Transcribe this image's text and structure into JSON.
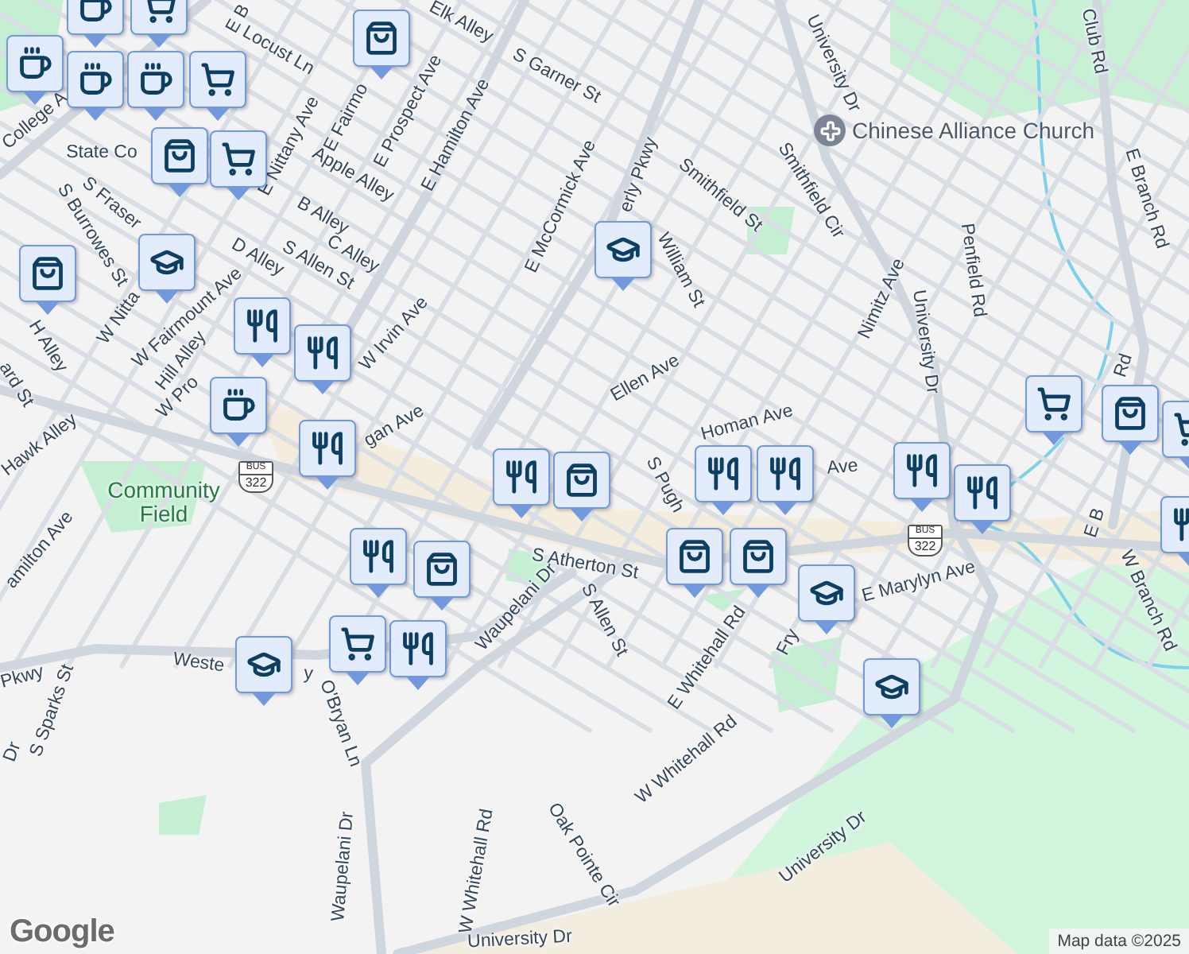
{
  "street_labels": [
    {
      "text": "Elk Alley"
    },
    {
      "text": "Locust Ln"
    },
    {
      "text": "S Garner St"
    },
    {
      "text": "E Fairmo"
    },
    {
      "text": "E Prospect Ave"
    },
    {
      "text": "E Hamilton Ave"
    },
    {
      "text": "Apple Alley"
    },
    {
      "text": "E Nittany Ave"
    },
    {
      "text": "B Alley"
    },
    {
      "text": "C Alley"
    },
    {
      "text": "S Allen St"
    },
    {
      "text": "D Alley"
    },
    {
      "text": "S Fraser"
    },
    {
      "text": "S Burrowes St"
    },
    {
      "text": "W Nitta"
    },
    {
      "text": "W Fairmount Ave"
    },
    {
      "text": "Hill Alley"
    },
    {
      "text": "W Irvin Ave"
    },
    {
      "text": "H Alley"
    },
    {
      "text": "Hawk Alley"
    },
    {
      "text": "E McCormick Ave"
    },
    {
      "text": "Smithfield St"
    },
    {
      "text": "Smithfield Cir"
    },
    {
      "text": "University Dr"
    },
    {
      "text": "Club Rd"
    },
    {
      "text": "E Branch Rd"
    },
    {
      "text": "Penfield Rd"
    },
    {
      "text": "Nimitz Ave"
    },
    {
      "text": "University Dr"
    },
    {
      "text": "Ellen Ave"
    },
    {
      "text": "Homan Ave"
    },
    {
      "text": "Ave"
    },
    {
      "text": "S Pugh"
    },
    {
      "text": "S Atherton St"
    },
    {
      "text": "S Allen St"
    },
    {
      "text": "E Whitehall Rd"
    },
    {
      "text": "Fry"
    },
    {
      "text": "E Marylyn Ave"
    },
    {
      "text": "W Branch Rd"
    },
    {
      "text": "Waupelani Dr"
    },
    {
      "text": "Waupelani Dr"
    },
    {
      "text": "O'Bryan Ln"
    },
    {
      "text": "Weste"
    },
    {
      "text": "y"
    },
    {
      "text": "Pkwy"
    },
    {
      "text": "S Sparks St"
    },
    {
      "text": "amilton Ave"
    },
    {
      "text": "W Whitehall Rd"
    },
    {
      "text": "Oak Pointe Cir"
    },
    {
      "text": "W Whitehall Rd"
    },
    {
      "text": "University Dr"
    },
    {
      "text": "University Dr"
    },
    {
      "text": "State Co"
    },
    {
      "text": "College A"
    },
    {
      "text": "W Pro"
    },
    {
      "text": "gan Ave"
    },
    {
      "text": "ard St"
    },
    {
      "text": "E B"
    },
    {
      "text": "William St"
    },
    {
      "text": "erly Pkwy"
    },
    {
      "text": "Dr"
    },
    {
      "text": "E B"
    },
    {
      "text": "Rd"
    }
  ],
  "area_labels": [
    {
      "text": "Community Field"
    }
  ],
  "poi": {
    "kind": "church",
    "name": "Chinese Alliance Church"
  },
  "route_shields": [
    {
      "network": "BUS",
      "number": "322"
    },
    {
      "network": "BUS",
      "number": "322"
    }
  ],
  "markers": [
    {
      "kind": "cafe"
    },
    {
      "kind": "grocery"
    },
    {
      "kind": "cafe"
    },
    {
      "kind": "cafe"
    },
    {
      "kind": "cafe"
    },
    {
      "kind": "grocery"
    },
    {
      "kind": "shop"
    },
    {
      "kind": "grocery"
    },
    {
      "kind": "shop"
    },
    {
      "kind": "school"
    },
    {
      "kind": "shop"
    },
    {
      "kind": "restaurant"
    },
    {
      "kind": "restaurant"
    },
    {
      "kind": "cafe"
    },
    {
      "kind": "restaurant"
    },
    {
      "kind": "shop"
    },
    {
      "kind": "restaurant"
    },
    {
      "kind": "restaurant"
    },
    {
      "kind": "shop"
    },
    {
      "kind": "restaurant"
    },
    {
      "kind": "grocery"
    },
    {
      "kind": "school"
    },
    {
      "kind": "school"
    },
    {
      "kind": "restaurant"
    },
    {
      "kind": "restaurant"
    },
    {
      "kind": "shop"
    },
    {
      "kind": "shop"
    },
    {
      "kind": "school"
    },
    {
      "kind": "school"
    },
    {
      "kind": "grocery"
    },
    {
      "kind": "shop"
    },
    {
      "kind": "restaurant"
    },
    {
      "kind": "restaurant"
    },
    {
      "kind": "restaurant"
    },
    {
      "kind": "grocery"
    }
  ],
  "attribution": {
    "logo": "Google",
    "text": "Map data ©2025"
  }
}
